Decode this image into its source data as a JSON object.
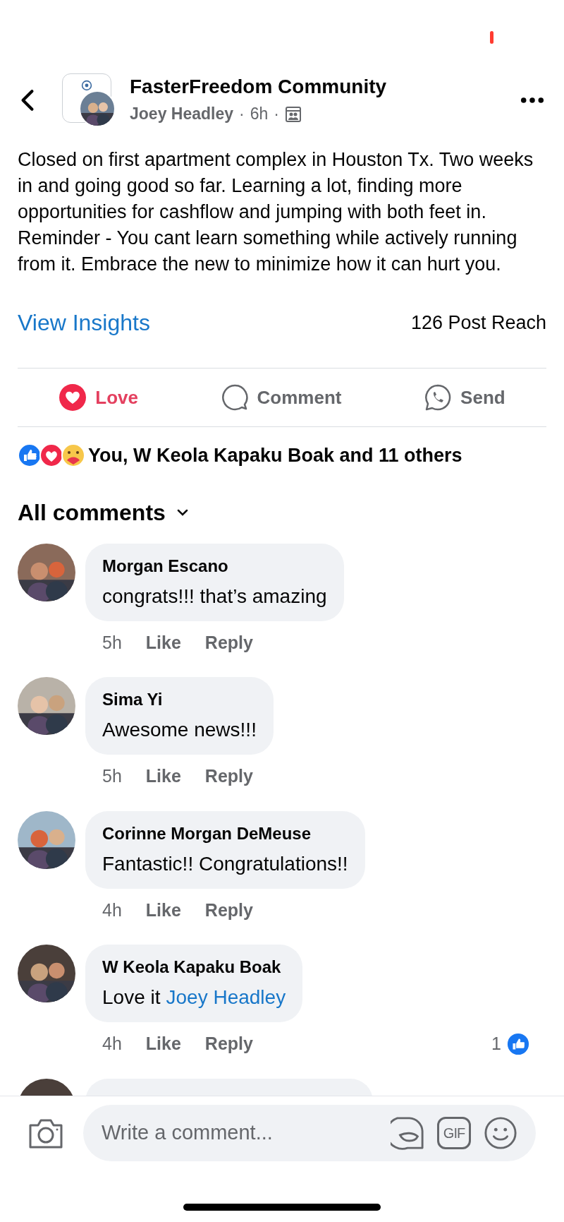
{
  "header": {
    "group": "FasterFreedom Community",
    "author": "Joey Headley",
    "time": "6h",
    "separator": "·"
  },
  "post": {
    "text": "Closed on first apartment complex in Houston Tx. Two weeks in and going good so far. Learning a lot, finding more opportunities for cashflow and jumping with both feet in. Reminder - You cant learn something while actively running from it. Embrace the new to minimize how it can hurt you.",
    "insights": "View Insights",
    "reach": "126 Post Reach"
  },
  "actions": [
    {
      "kind": "love",
      "label": "Love",
      "selected": true
    },
    {
      "kind": "comment",
      "label": "Comment",
      "selected": false
    },
    {
      "kind": "send",
      "label": "Send",
      "selected": false
    }
  ],
  "reactions": {
    "summary": "You, W Keola Kapaku Boak and 11 others"
  },
  "sort": {
    "label": "All comments"
  },
  "comments": [
    {
      "name": "Morgan Escano",
      "text": "congrats!!! that’s amazing",
      "time": "5h",
      "like": "Like",
      "reply": "Reply"
    },
    {
      "name": "Sima Yi",
      "text": "Awesome news!!!",
      "time": "5h",
      "like": "Like",
      "reply": "Reply"
    },
    {
      "name": "Corinne Morgan DeMeuse",
      "text": "Fantastic!!  Congratulations!!",
      "time": "4h",
      "like": "Like",
      "reply": "Reply"
    },
    {
      "name": "W Keola Kapaku Boak",
      "text": "Love it",
      "mention": "Joey Headley",
      "time": "4h",
      "like": "Like",
      "reply": "Reply",
      "likes": "1"
    }
  ],
  "composer": {
    "placeholder": "Write a comment...",
    "gif": "GIF"
  }
}
